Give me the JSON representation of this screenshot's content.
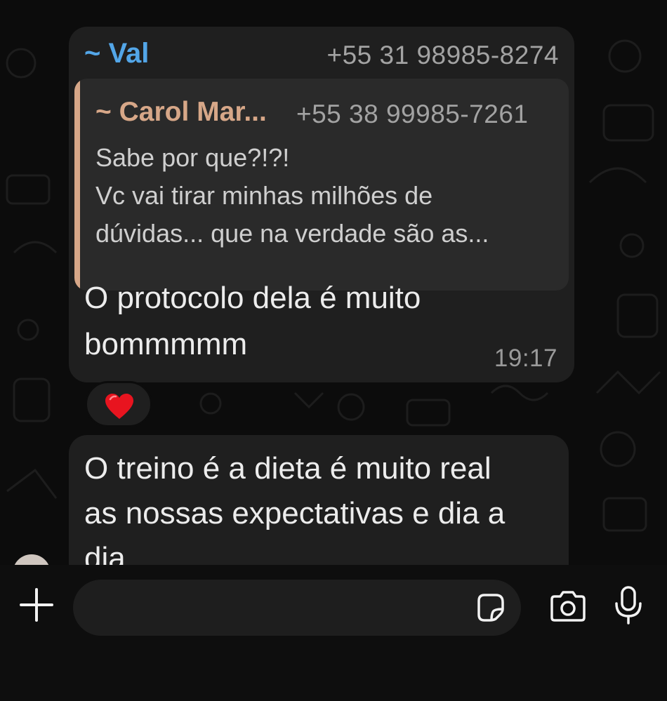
{
  "message1": {
    "sender_name": "~ Val",
    "sender_phone": "+55 31 98985-8274",
    "quote": {
      "name": "~ Carol Mar...",
      "phone": "+55 38 99985-7261",
      "lines": [
        "Sabe por que?!?!",
        "Vc vai tirar minhas milhões de",
        "dúvidas... que na verdade são as..."
      ]
    },
    "text_lines": [
      "O protocolo dela é muito",
      "bommmmm"
    ],
    "time": "19:17",
    "reaction": "heart"
  },
  "message2": {
    "text_lines": [
      "O treino é a dieta é muito real",
      "as nossas expectativas e dia a",
      "dia"
    ]
  },
  "composer": {
    "placeholder": ""
  },
  "icons": {
    "attach": "plus-icon",
    "sticker": "sticker-icon",
    "camera": "camera-icon",
    "mic": "microphone-icon"
  },
  "colors": {
    "sender_name": "#53a6e8",
    "quoted_name": "#d7a788",
    "bubble": "#1f1f1f",
    "quote_bg": "#2a2a2a"
  }
}
